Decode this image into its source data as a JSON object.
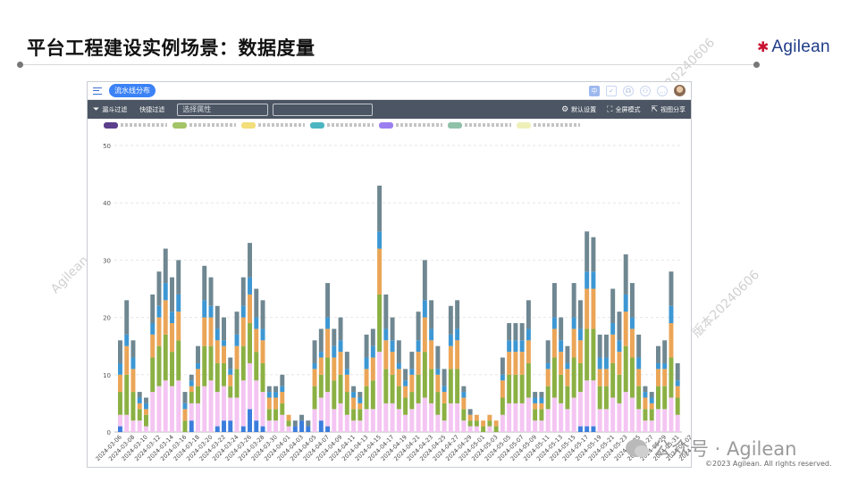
{
  "slide": {
    "title": "平台工程建设实例场景：数据度量",
    "logo_text": "Agilean",
    "watermarks": [
      "Agilean",
      "版本20240606",
      "版本20240606",
      "版本20240606"
    ],
    "wechat_text": "公众号 · Agilean",
    "copyright": "©2023 Agilean. All rights reserved."
  },
  "app": {
    "view_label": "流水线分布",
    "toolbar": {
      "funnel_filter": "漏斗过滤",
      "quick_filter": "快捷过滤",
      "select_placeholder": "选择属性",
      "default_settings": "默认设置",
      "fullscreen": "全屏模式",
      "share_view": "视图分享"
    },
    "top_icons": [
      "lang-icon",
      "check-icon",
      "support-icon",
      "tree-icon",
      "chat-icon",
      "avatar"
    ],
    "lang_label": "中"
  },
  "legend_colors": [
    "#5b3f8c",
    "#a3c467",
    "#f2de7a",
    "#4bb6c1",
    "#9b7ff0",
    "#8fc1a9",
    "#eef0b8"
  ],
  "chart_data": {
    "type": "bar",
    "stacked": true,
    "ylim": [
      0,
      50
    ],
    "yticks": [
      0,
      10,
      20,
      30,
      40,
      50
    ],
    "grid": true,
    "legend_placement": "top",
    "tick_labels": [
      "2024-03-06",
      "2024-03-08",
      "2024-03-10",
      "2024-03-12",
      "2024-03-14",
      "2024-03-16",
      "2024-03-18",
      "2024-03-20",
      "2024-03-22",
      "2024-03-24",
      "2024-03-26",
      "2024-03-28",
      "2024-03-30",
      "2024-04-01",
      "2024-04-03",
      "2024-04-05",
      "2024-04-07",
      "2024-04-09",
      "2024-04-11",
      "2024-04-13",
      "2024-04-15",
      "2024-04-17",
      "2024-04-19",
      "2024-04-21",
      "2024-04-23",
      "2024-04-25",
      "2024-04-27",
      "2024-04-29",
      "2024-05-01",
      "2024-05-03",
      "2024-05-05",
      "2024-05-07",
      "2024-05-09",
      "2024-05-11",
      "2024-05-13",
      "2024-05-15",
      "2024-05-17",
      "2024-05-19",
      "2024-05-21",
      "2024-05-23",
      "2024-05-25",
      "2024-05-27",
      "2024-05-29",
      "2024-05-31",
      "2024-06-02",
      "2024-06-04"
    ],
    "series_colors": [
      "#3b7ddd",
      "#f4c5f2",
      "#8bb043",
      "#eba557",
      "#3d97d3",
      "#6f8791"
    ],
    "totals": [
      16,
      23,
      16,
      7,
      6,
      24,
      28,
      32,
      27,
      30,
      7,
      10,
      15,
      29,
      27,
      22,
      20,
      13,
      21,
      27,
      33,
      25,
      23,
      8,
      8,
      10,
      3,
      2,
      3,
      2,
      16,
      18,
      26,
      18,
      20,
      14,
      8,
      7,
      17,
      18,
      43,
      24,
      20,
      16,
      11,
      14,
      21,
      30,
      23,
      15,
      11,
      22,
      23,
      8,
      4,
      3,
      2,
      3,
      2,
      13,
      19,
      19,
      19,
      23,
      7,
      7,
      16,
      26,
      20,
      15,
      26,
      23,
      35,
      34,
      17,
      17,
      25,
      21,
      31,
      26,
      17,
      8,
      7,
      15,
      16,
      28,
      12
    ],
    "values_by_series": {
      "blue": [
        1,
        0,
        0,
        0,
        0,
        0,
        0,
        0,
        0,
        0,
        0,
        2,
        0,
        0,
        0,
        1,
        2,
        2,
        0,
        1,
        4,
        2,
        1,
        0,
        0,
        0,
        0,
        1,
        2,
        1,
        0,
        2,
        1,
        0,
        0,
        0,
        0,
        0,
        0,
        0,
        0,
        0,
        0,
        0,
        0,
        0,
        0,
        0,
        0,
        0,
        0,
        0,
        0,
        0,
        0,
        0,
        0,
        0,
        0,
        0,
        0,
        0,
        0,
        0,
        0,
        0,
        0,
        0,
        0,
        0,
        0,
        1,
        1,
        1,
        0,
        0,
        0,
        0,
        0,
        0,
        0,
        0,
        0,
        0,
        0,
        0,
        0
      ],
      "pink": [
        2,
        3,
        2,
        2,
        1,
        7,
        8,
        9,
        8,
        9,
        0,
        3,
        5,
        8,
        9,
        6,
        6,
        4,
        6,
        8,
        8,
        7,
        6,
        2,
        2,
        3,
        1,
        0,
        0,
        0,
        4,
        4,
        6,
        4,
        5,
        3,
        2,
        2,
        4,
        4,
        14,
        5,
        5,
        4,
        3,
        4,
        5,
        6,
        5,
        3,
        2,
        5,
        5,
        2,
        1,
        1,
        0,
        1,
        0,
        3,
        5,
        5,
        5,
        6,
        2,
        2,
        4,
        6,
        5,
        4,
        6,
        6,
        8,
        8,
        4,
        4,
        6,
        5,
        7,
        6,
        4,
        2,
        2,
        4,
        4,
        6,
        3
      ]
    }
  }
}
